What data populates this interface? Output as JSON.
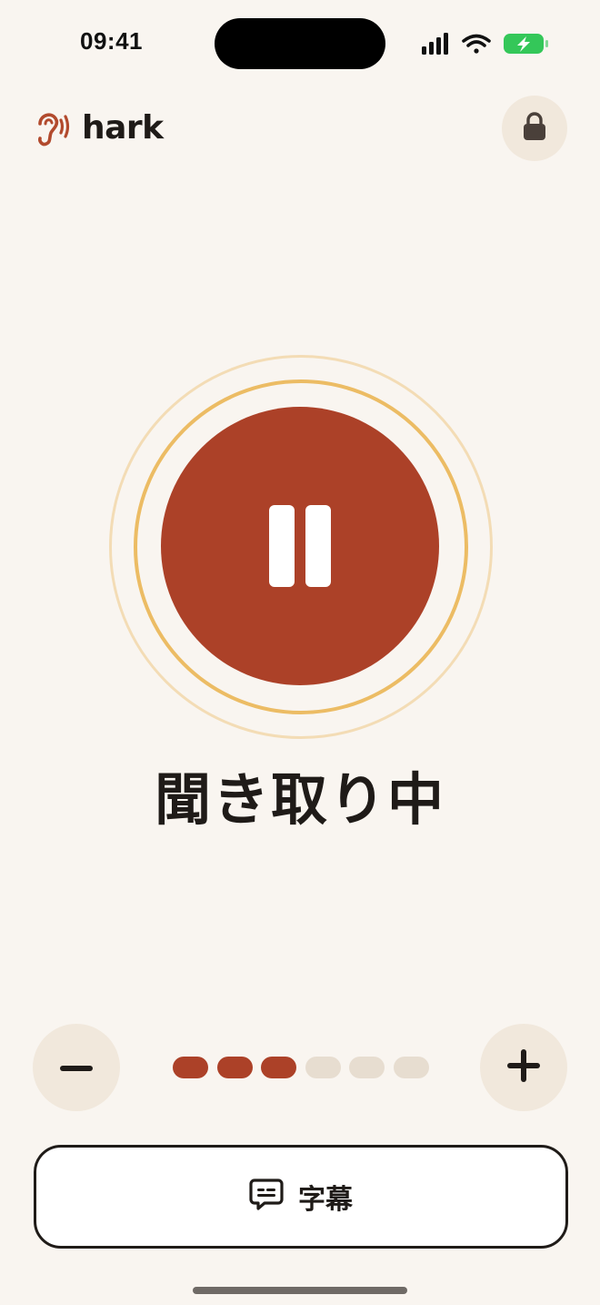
{
  "status_bar": {
    "time": "09:41",
    "icons": [
      "signal-icon",
      "wifi-icon",
      "battery-charging-icon"
    ],
    "battery_color": "#34c759"
  },
  "header": {
    "app_name": "hark",
    "logo_icon": "ear-icon",
    "lock_icon": "lock-icon"
  },
  "listen": {
    "state_label": "聞き取り中",
    "control_icon": "pause-icon",
    "accent_color": "#ac4128",
    "ring_color": "#ecbc64"
  },
  "volume": {
    "level": 3,
    "max": 6,
    "decrease_icon": "minus-icon",
    "increase_icon": "plus-icon"
  },
  "captions": {
    "label": "字幕",
    "icon": "caption-bubble-icon"
  }
}
